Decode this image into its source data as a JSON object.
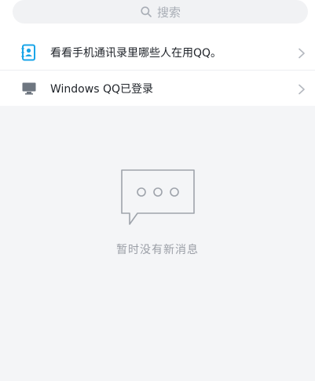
{
  "search": {
    "placeholder": "搜索",
    "icon": "search-icon"
  },
  "list": {
    "items": [
      {
        "label": "看看手机通讯录里哪些人在用QQ。",
        "icon": "contacts-book-icon",
        "icon_color": "#1aa5e8"
      },
      {
        "label": "Windows QQ已登录",
        "icon": "desktop-monitor-icon",
        "icon_color": "#6e7680"
      }
    ],
    "chevron_icon": "chevron-right-icon"
  },
  "empty_state": {
    "icon": "chat-bubble-icon",
    "message": "暂时没有新消息"
  },
  "colors": {
    "background": "#f4f5f7",
    "surface": "#ffffff",
    "muted_text": "#9a9ea6"
  }
}
